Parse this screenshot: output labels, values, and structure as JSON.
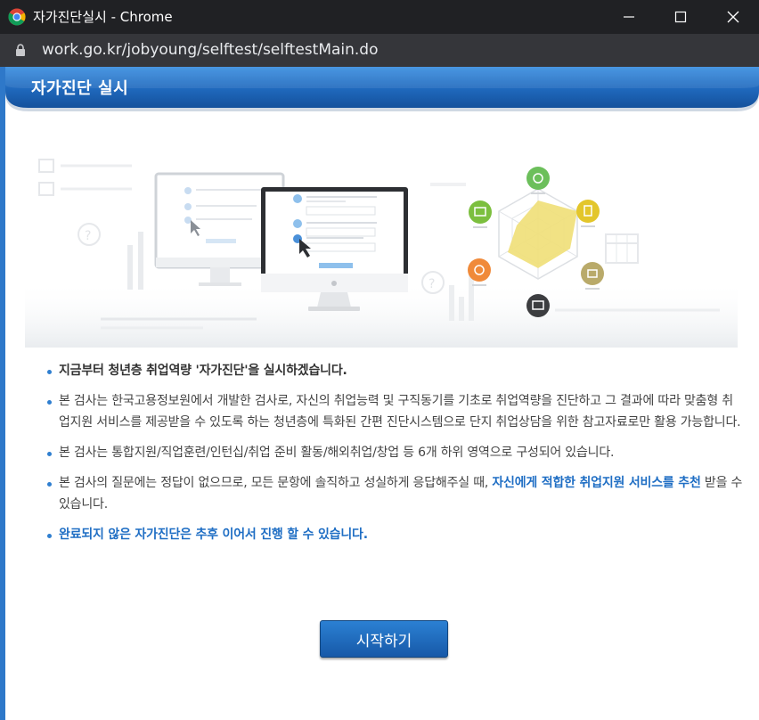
{
  "window": {
    "title": "자가진단실시 - Chrome",
    "url": "work.go.kr/jobyoung/selftest/selftestMain.do"
  },
  "header": {
    "title": "자가진단 실시"
  },
  "content": {
    "bullet1": "지금부터 청년층 취업역량 '자가진단'을 실시하겠습니다.",
    "bullet2": "본 검사는 한국고용정보원에서 개발한 검사로, 자신의 취업능력 및 구직동기를 기초로 취업역량을 진단하고 그 결과에 따라 맞춤형 취업지원 서비스를 제공받을 수 있도록 하는 청년층에 특화된 간편 진단시스템으로 단지 취업상담을 위한 참고자료로만 활용 가능합니다.",
    "bullet3": "본 검사는 통합지원/직업훈련/인턴십/취업 준비 활동/해외취업/창업 등 6개 하위 영역으로 구성되어 있습니다.",
    "bullet4_pre": "본 검사의 질문에는 정답이 없으므로, 모든 문항에 솔직하고 성실하게 응답해주실 때, ",
    "bullet4_highlight": "자신에게 적합한 취업지원 서비스를 추천",
    "bullet4_post": " 받을 수 있습니다.",
    "bullet5": "완료되지 않은 자가진단은 추후 이어서 진행 할 수 있습니다."
  },
  "start_button": {
    "label": "시작하기"
  },
  "icons": {
    "app": "chrome-icon",
    "minimize": "minimize-icon",
    "maximize": "maximize-icon",
    "close": "close-icon",
    "lock": "lock-icon"
  },
  "colors": {
    "titlebar": "#202124",
    "addressbar": "#35363a",
    "header_blue": "#1e64b4",
    "accent_blue": "#1f6ec4",
    "radar_fill": "#f0e07a",
    "button_blue": "#1d68b9"
  }
}
